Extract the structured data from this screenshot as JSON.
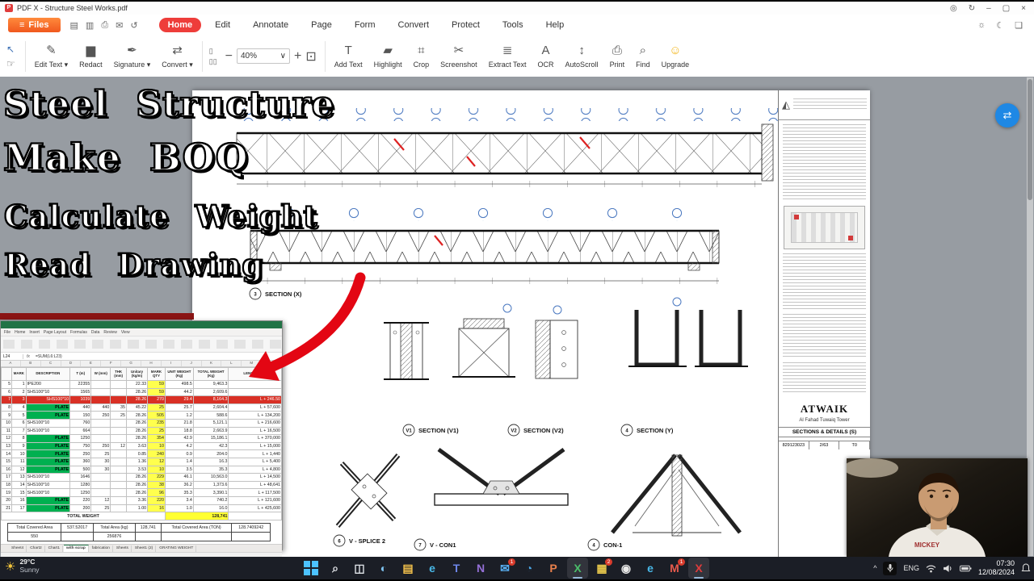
{
  "window": {
    "title": "PDF X - Structure Steel Works.pdf"
  },
  "ribbon": {
    "files_label": "Files",
    "quick_icons": [
      {
        "name": "open-file-icon",
        "glyph": "▤"
      },
      {
        "name": "save-icon",
        "glyph": "▥"
      },
      {
        "name": "print-quick-icon",
        "glyph": "⎙"
      },
      {
        "name": "mail-icon",
        "glyph": "✉"
      },
      {
        "name": "undo-icon",
        "glyph": "↺"
      }
    ],
    "tabs": [
      {
        "label": "Home",
        "active": true
      },
      {
        "label": "Edit"
      },
      {
        "label": "Annotate"
      },
      {
        "label": "Page"
      },
      {
        "label": "Form"
      },
      {
        "label": "Convert"
      },
      {
        "label": "Protect"
      },
      {
        "label": "Tools"
      },
      {
        "label": "Help"
      }
    ],
    "zoom_value": "40%",
    "left_tools": [
      {
        "label": "Edit Text",
        "glyph": "✎",
        "caret": true
      },
      {
        "label": "Redact",
        "glyph": "▆",
        "caret": false
      },
      {
        "label": "Signature",
        "glyph": "✒",
        "caret": true
      },
      {
        "label": "Convert",
        "glyph": "⇄",
        "caret": true
      }
    ],
    "right_tools": [
      {
        "label": "Add Text",
        "glyph": "T"
      },
      {
        "label": "Highlight",
        "glyph": "▰"
      },
      {
        "label": "Crop",
        "glyph": "⌗"
      },
      {
        "label": "Screenshot",
        "glyph": "✂"
      },
      {
        "label": "Extract Text",
        "glyph": "≣"
      },
      {
        "label": "OCR",
        "glyph": "A"
      },
      {
        "label": "AutoScroll",
        "glyph": "↕"
      },
      {
        "label": "Print",
        "glyph": "⎙"
      },
      {
        "label": "Find",
        "glyph": "⌕"
      },
      {
        "label": "Upgrade",
        "glyph": "☺"
      }
    ]
  },
  "overlay": {
    "line1": "Steel Structure",
    "line2": "Make BOQ",
    "line3": "Calculate Weight",
    "line4": "Read Drawing"
  },
  "drawing": {
    "labels": {
      "section_x": "SECTION (X)",
      "section_v1": "SECTION (V1)",
      "section_v2": "SECTION (V2)",
      "section_y": "SECTION (Y)",
      "splice": "V - SPLICE 2",
      "vcon1": "V - CON1",
      "con1": "CON-1"
    },
    "bubbles": {
      "section_x": "3",
      "section_v1": "V1",
      "section_v2": "V2",
      "section_y": "4",
      "splice": "6",
      "vcon1": "7",
      "con1": "4"
    },
    "titleblock": {
      "company": "ATWAIK",
      "project": "Al Fahad Tuwaiq Tower",
      "sheet_title": "SECTIONS & DETAILS (S)",
      "doc_no": "829123023",
      "sheet_no": "2/63",
      "rev": "T0"
    }
  },
  "excel": {
    "name_box": "L24",
    "formula": "=SUM(L6:L23)",
    "ribbon_tabs": [
      "File",
      "Home",
      "Insert",
      "Page Layout",
      "Formulas",
      "Data",
      "Review",
      "View"
    ],
    "col_letters": [
      "A",
      "B",
      "C",
      "D",
      "E",
      "F",
      "G",
      "H",
      "I",
      "J",
      "K",
      "L",
      "M",
      "N"
    ]
  },
  "spreadsheet": {
    "columns": [
      "",
      "MARK",
      "DESCRIPTION",
      "T (m)",
      "W (mm)",
      "THK (mm)",
      "Unitary (kg/m)",
      "MARK QTY",
      "UNIT WEIGHT (Kg)",
      "TOTAL WEIGHT (Kg)",
      "LENGTH AND"
    ],
    "rows": [
      {
        "c": [
          "5",
          "1",
          "IPE200",
          "22355",
          "",
          "",
          "22.33",
          "59",
          "498.5",
          "9,463.3",
          ""
        ]
      },
      {
        "c": [
          "6",
          "2",
          "SHS100*10",
          "1565",
          "",
          "",
          "28.26",
          "59",
          "44.2",
          "2,609.6",
          ""
        ]
      },
      {
        "c": [
          "7",
          "3",
          "SHS100*10",
          "1039",
          "",
          "",
          "28.26",
          "270",
          "29.4",
          "8,164.3",
          "L + 246.50"
        ],
        "hl": "red"
      },
      {
        "c": [
          "8",
          "4",
          "PLATE",
          "440",
          "440",
          "35",
          "45.22",
          "25",
          "25.7",
          "2,604.4",
          "L + 57,600"
        ],
        "hl": "green"
      },
      {
        "c": [
          "9",
          "5",
          "PLATE",
          "150",
          "250",
          "25",
          "28.26",
          "505",
          "1.2",
          "588.6",
          "L + 134,200"
        ],
        "hl": "green"
      },
      {
        "c": [
          "10",
          "6",
          "SHS100*10",
          "760",
          "",
          "",
          "28.26",
          "235",
          "21.8",
          "5,121.1",
          "L + 216,600"
        ]
      },
      {
        "c": [
          "11",
          "7",
          "SHS100*10",
          "664",
          "",
          "",
          "28.26",
          "25",
          "18.8",
          "2,663.9",
          "L + 16,500"
        ]
      },
      {
        "c": [
          "12",
          "8",
          "PLATE",
          "1250",
          "",
          "",
          "28.26",
          "354",
          "42.9",
          "15,186.1",
          "L + 370,000"
        ],
        "hl": "green"
      },
      {
        "c": [
          "13",
          "9",
          "PLATE",
          "750",
          "250",
          "12",
          "3.63",
          "10",
          "4.2",
          "42.3",
          "L + 15,000"
        ],
        "hl": "green"
      },
      {
        "c": [
          "14",
          "10",
          "PLATE",
          "250",
          "25",
          "",
          "0.85",
          "240",
          "0.9",
          "204.0",
          "L + 1,440"
        ],
        "hl": "green"
      },
      {
        "c": [
          "15",
          "11",
          "PLATE",
          "360",
          "30",
          "",
          "1.36",
          "12",
          "1.4",
          "16.3",
          "L + 5,400"
        ],
        "hl": "green"
      },
      {
        "c": [
          "16",
          "12",
          "PLATE",
          "500",
          "30",
          "",
          "3.53",
          "10",
          "3.5",
          "35.3",
          "L + 4,800"
        ],
        "hl": "green"
      },
      {
        "c": [
          "17",
          "13",
          "SHS100*10",
          "1646",
          "",
          "",
          "28.26",
          "229",
          "46.1",
          "10,563.0",
          "L + 14,500"
        ]
      },
      {
        "c": [
          "18",
          "14",
          "SHS100*10",
          "1280",
          "",
          "",
          "28.26",
          "38",
          "36.2",
          "1,373.6",
          "L + 48,641"
        ]
      },
      {
        "c": [
          "19",
          "15",
          "SHS100*10",
          "1250",
          "",
          "",
          "28.26",
          "96",
          "35.3",
          "3,390.1",
          "L + 117,500"
        ]
      },
      {
        "c": [
          "20",
          "16",
          "PLATE",
          "220",
          "12",
          "",
          "3.36",
          "220",
          "3.4",
          "740.2",
          "L + 121,600"
        ],
        "hl": "green"
      },
      {
        "c": [
          "21",
          "17",
          "PLATE",
          "200",
          "25",
          "",
          "1.00",
          "16",
          "1.0",
          "16.0",
          "L + 425,600"
        ],
        "hl": "green"
      }
    ],
    "total_label": "TOTAL WEIGHT",
    "total_value": "128,741",
    "summary": [
      [
        "Total Covered Area",
        "537.52017",
        "Total  Area (kg)",
        "128,741",
        "Total Covered Area (TON)",
        "128.7409242"
      ],
      [
        "550",
        "",
        "256876",
        "",
        "",
        ""
      ]
    ],
    "sheet_tabs": [
      "Sheet4",
      "Chart2",
      "Chart1",
      "with scrap",
      "fabrication",
      "Sheets",
      "Sheet1 (2)",
      "GRATING WEIGHT"
    ],
    "active_tab": 3
  },
  "webcam": {
    "shirt_text": "MICKEY"
  },
  "taskbar": {
    "weather_temp": "29°C",
    "weather_desc": "Sunny",
    "apps": [
      {
        "name": "start",
        "glyph": "WIN",
        "color": "#4cc2ff"
      },
      {
        "name": "search",
        "glyph": "⌕",
        "color": "#e8eaee"
      },
      {
        "name": "task-view",
        "glyph": "◫",
        "color": "#dfe3e8"
      },
      {
        "name": "copilot",
        "glyph": "◐",
        "color": "#7ec3f0"
      },
      {
        "name": "file-explorer",
        "glyph": "▤",
        "color": "#f2c04b"
      },
      {
        "name": "edge",
        "glyph": "e",
        "color": "#49b8e8"
      },
      {
        "name": "teams",
        "glyph": "T",
        "color": "#6d86e8"
      },
      {
        "name": "onenote",
        "glyph": "N",
        "color": "#9570d8"
      },
      {
        "name": "outlook",
        "glyph": "✉",
        "color": "#58aef0",
        "badge": "1"
      },
      {
        "name": "onedrive",
        "glyph": "◔",
        "color": "#4aa3e0"
      },
      {
        "name": "powerpoint",
        "glyph": "P",
        "color": "#e8804c"
      },
      {
        "name": "excel",
        "glyph": "X",
        "color": "#4bbf6b",
        "active": true
      },
      {
        "name": "power-bi",
        "glyph": "▦",
        "color": "#e8c84c",
        "badge": "2"
      },
      {
        "name": "chrome",
        "glyph": "◉",
        "color": "#e8e8e8"
      },
      {
        "name": "edge-2",
        "glyph": "e",
        "color": "#49b8e8"
      },
      {
        "name": "gmail",
        "glyph": "M",
        "color": "#e85a4c",
        "badge": "1"
      },
      {
        "name": "app-red-x",
        "glyph": "X",
        "color": "#e03c3c",
        "active": true
      }
    ],
    "tray": {
      "lang": "ENG",
      "time": "07:30",
      "date": "12/08/2024"
    }
  }
}
